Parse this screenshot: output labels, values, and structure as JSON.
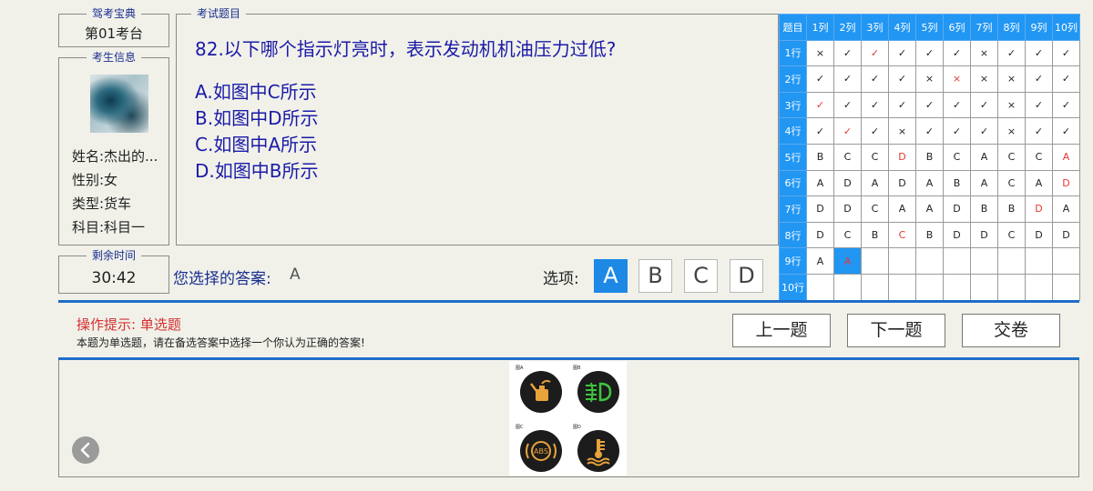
{
  "exam_station": {
    "title": "驾考宝典",
    "value": "第01考台"
  },
  "candidate": {
    "title": "考生信息",
    "name": "姓名:杰出的...",
    "gender": "性别:女",
    "type": "类型:货车",
    "subject": "科目:科目一"
  },
  "timer": {
    "title": "剩余时间",
    "value": "30:42"
  },
  "question": {
    "title": "考试题目",
    "text": "82.以下哪个指示灯亮时，表示发动机机油压力过低?",
    "options": [
      "A.如图中C所示",
      "B.如图中D所示",
      "C.如图中A所示",
      "D.如图中B所示"
    ]
  },
  "answer": {
    "label": "您选择的答案:",
    "value": "A"
  },
  "choices": {
    "label": "选项:",
    "buttons": [
      "A",
      "B",
      "C",
      "D"
    ],
    "selected": "A"
  },
  "grid": {
    "corner": "题目",
    "columns": [
      "1列",
      "2列",
      "3列",
      "4列",
      "5列",
      "6列",
      "7列",
      "8列",
      "9列",
      "10列"
    ],
    "rows": [
      {
        "label": "1行",
        "cells": [
          "×",
          "✓",
          "✓",
          "✓",
          "✓",
          "✓",
          "×",
          "✓",
          "✓",
          "✓"
        ],
        "red": [
          2
        ]
      },
      {
        "label": "2行",
        "cells": [
          "✓",
          "✓",
          "✓",
          "✓",
          "×",
          "×",
          "×",
          "×",
          "✓",
          "✓"
        ],
        "red": [
          5
        ]
      },
      {
        "label": "3行",
        "cells": [
          "✓",
          "✓",
          "✓",
          "✓",
          "✓",
          "✓",
          "✓",
          "×",
          "✓",
          "✓"
        ],
        "red": [
          0
        ]
      },
      {
        "label": "4行",
        "cells": [
          "✓",
          "✓",
          "✓",
          "×",
          "✓",
          "✓",
          "✓",
          "×",
          "✓",
          "✓"
        ],
        "red": [
          1
        ]
      },
      {
        "label": "5行",
        "cells": [
          "B",
          "C",
          "C",
          "D",
          "B",
          "C",
          "A",
          "C",
          "C",
          "A"
        ],
        "red": [
          3,
          9
        ]
      },
      {
        "label": "6行",
        "cells": [
          "A",
          "D",
          "A",
          "D",
          "A",
          "B",
          "A",
          "C",
          "A",
          "D"
        ],
        "red": [
          9
        ]
      },
      {
        "label": "7行",
        "cells": [
          "D",
          "D",
          "C",
          "A",
          "A",
          "D",
          "B",
          "B",
          "D",
          "A"
        ],
        "red": [
          8
        ]
      },
      {
        "label": "8行",
        "cells": [
          "D",
          "C",
          "B",
          "C",
          "B",
          "D",
          "D",
          "C",
          "D",
          "D"
        ],
        "red": [
          3
        ]
      },
      {
        "label": "9行",
        "cells": [
          "A",
          "A",
          "",
          "",
          "",
          "",
          "",
          "",
          "",
          ""
        ],
        "red": [],
        "current": 1
      },
      {
        "label": "10行",
        "cells": [
          "",
          "",
          "",
          "",
          "",
          "",
          "",
          "",
          "",
          ""
        ],
        "red": []
      }
    ]
  },
  "hint": {
    "title": "操作提示: 单选题",
    "text": "本题为单选题，请在备选答案中选择一个你认为正确的答案!"
  },
  "actions": {
    "prev": "上一题",
    "next": "下一题",
    "submit": "交卷"
  },
  "figure": {
    "labels": [
      "图A",
      "图B",
      "图C",
      "图D"
    ],
    "lamp_colors": {
      "A": "#e8a33a",
      "B": "#3ec43e",
      "C": "#e8a33a",
      "D": "#e8a33a"
    },
    "lamp_text_c": "ABS",
    "icons": [
      "oil-can-icon",
      "fog-light-icon",
      "abs-icon",
      "coolant-temperature-icon"
    ]
  },
  "colors": {
    "accent": "#2196f3",
    "question": "#1a1aa8",
    "error": "#e53935",
    "divider": "#1e6ec8"
  }
}
